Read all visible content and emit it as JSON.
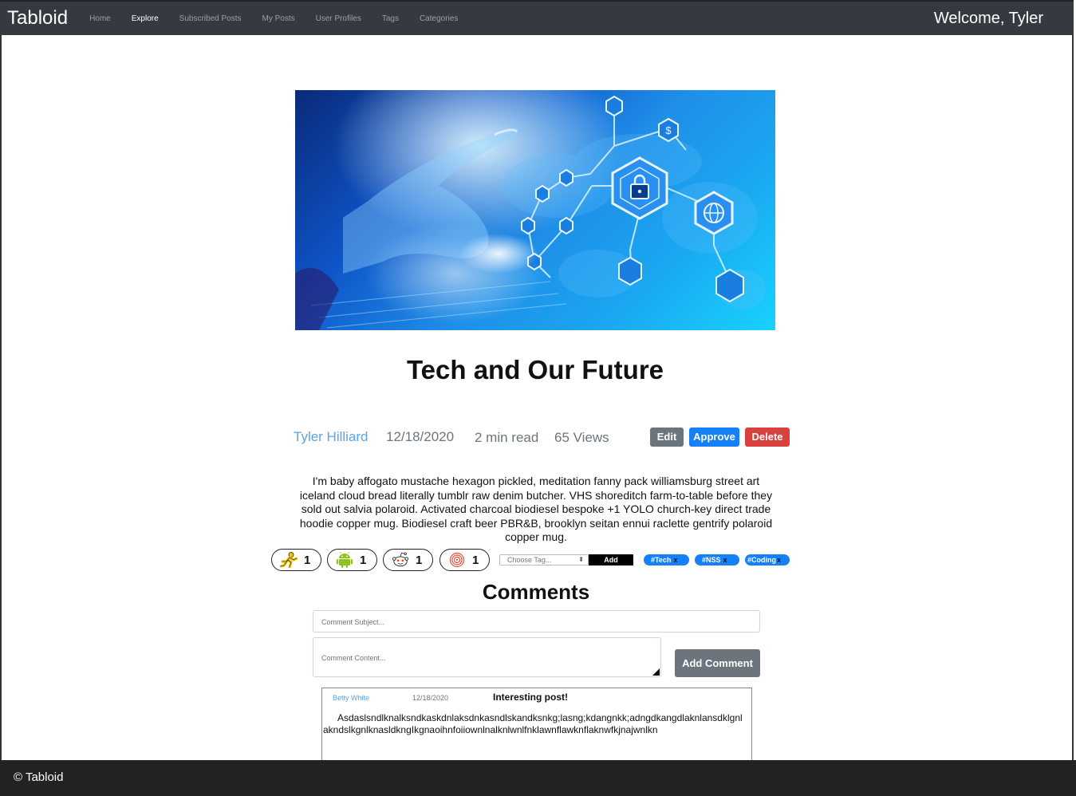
{
  "navbar": {
    "brand": "Tabloid",
    "links": [
      {
        "label": "Home"
      },
      {
        "label": "Explore"
      },
      {
        "label": "Subscribed Posts"
      },
      {
        "label": "My Posts"
      },
      {
        "label": "User Profiles"
      },
      {
        "label": "Tags"
      },
      {
        "label": "Categories"
      }
    ],
    "active": "Explore",
    "welcome": "Welcome, Tyler"
  },
  "post": {
    "title": "Tech and Our Future",
    "author": "Tyler Hilliard",
    "date": "12/18/2020",
    "read_time": "2 min read",
    "views": "65 Views",
    "body": "I'm baby affogato mustache hexagon pickled, meditation fanny pack williamsburg street art iceland cloud bread literally tumblr raw denim butcher. VHS shoreditch farm-to-table before they sold out salvia polaroid. Activated charcoal biodiesel bespoke +1 YOLO church-key direct trade hoodie copper mug. Biodiesel craft beer PBR&B, brooklyn seitan ennui raclette gentrify polaroid copper mug."
  },
  "actions": {
    "edit": "Edit",
    "approve": "Approve",
    "delete": "Delete"
  },
  "reactions": [
    {
      "icon": "aim-running-man-icon",
      "count": "1",
      "color": "#f2c200"
    },
    {
      "icon": "android-icon",
      "count": "1",
      "color": "#8fc31f"
    },
    {
      "icon": "reddit-alien-icon",
      "count": "1",
      "color": "#ff4500"
    },
    {
      "icon": "target-swirl-icon",
      "count": "1",
      "color": "#e8503a"
    }
  ],
  "tagging": {
    "select_placeholder": "Choose Tag...",
    "add_label": "Add",
    "tags": [
      {
        "label": "#Tech",
        "remove": "x"
      },
      {
        "label": "#NSS",
        "remove": "x"
      },
      {
        "label": "#Coding",
        "remove": "x"
      }
    ]
  },
  "comments": {
    "heading": "Comments",
    "subject_placeholder": "Comment Subject...",
    "content_placeholder": "Comment Content...",
    "add_label": "Add Comment",
    "items": [
      {
        "author": "Betty White",
        "date": "12/18/2020",
        "subject": "Interesting post!",
        "content": "Asdaslsndlknalksndkaskdnlaksdnkasndlskandksnkg;lasng;kdangnkk;adngdkangdlaknlansdklgnlakndslkgnlknasldkngIkgnaoihnfoiiownlnalknlwnlfnklawnflawknflaknwfkjnajwnlkn"
      }
    ]
  },
  "footer": {
    "text": "© Tabloid"
  },
  "colors": {
    "navbar_bg": "#343a40",
    "primary": "#1580f8",
    "danger": "#d9413f",
    "secondary": "#6c757d",
    "link": "#5aa3e8",
    "footer_bg": "#222222"
  }
}
